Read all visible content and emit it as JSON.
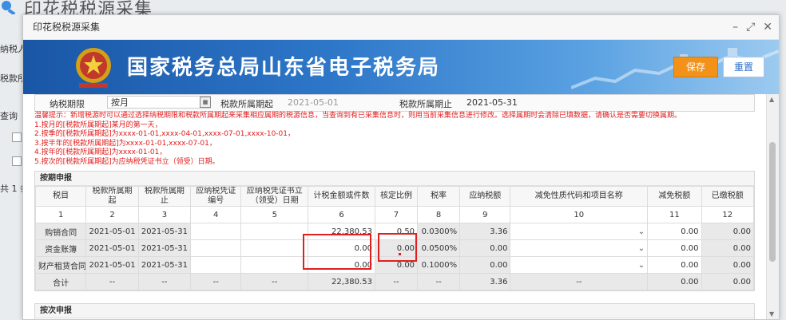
{
  "background": {
    "page_title": "印花税税源采集",
    "side_labels": [
      "纳税人",
      "税款所",
      "查询",
      "共 1 条"
    ]
  },
  "dialog": {
    "title": "印花税税源采集",
    "bureau_name": "国家税务总局山东省电子税务局",
    "buttons": {
      "save": "保存",
      "reset": "重置"
    }
  },
  "period": {
    "period_label": "纳税期限",
    "period_value": "按月",
    "start_label": "税款所属期起",
    "start_value": "2021-05-01",
    "end_label": "税款所属期止",
    "end_value": "2021-05-31"
  },
  "tips": [
    "温馨提示：新增税源时可以通过选择纳税期限和税款所属期起来采集相应属期的税源信息，当查询到有已采集信息时，则用当前采集信息进行修改。选择属期时会清除已填数据，请确认是否需要切换属期。",
    "1.按月的[税款所属期起]某月的第一天，",
    "2.按季的[税款所属期起]为xxxx-01-01,xxxx-04-01,xxxx-07-01,xxxx-10-01，",
    "3.按半年的[税款所属期起]为xxxx-01-01,xxxx-07-01，",
    "4.按年的[税款所属期起]为xxxx-01-01，",
    "5.按次的[税款所属期起]为应纳税凭证书立（领受）日期。"
  ],
  "period_section": {
    "title": "按期申报",
    "headers": [
      "税目",
      "税款所属期起",
      "税款所属期止",
      "应纳税凭证编号",
      "应纳税凭证书立（领受）日期",
      "计税金额或件数",
      "核定比例",
      "税率",
      "应纳税额",
      "减免性质代码和项目名称",
      "减免税额",
      "已缴税额"
    ],
    "col_numbers": [
      "1",
      "2",
      "3",
      "4",
      "5",
      "6",
      "7",
      "8",
      "9",
      "10",
      "11",
      "12"
    ],
    "rows": [
      {
        "item": "购销合同",
        "start": "2021-05-01",
        "end": "2021-05-31",
        "voucher_no": "",
        "voucher_date": "",
        "amount": "22,380.53",
        "ratio": "0.50",
        "rate": "0.0300%",
        "tax": "3.36",
        "relief_code": "",
        "relief_tax": "0.00",
        "paid_tax": "0.00"
      },
      {
        "item": "资金账簿",
        "start": "2021-05-01",
        "end": "2021-05-31",
        "voucher_no": "",
        "voucher_date": "",
        "amount": "0.00",
        "ratio": "0.00",
        "rate": "0.0500%",
        "tax": "0.00",
        "relief_code": "",
        "relief_tax": "0.00",
        "paid_tax": "0.00"
      },
      {
        "item": "财产租赁合同",
        "start": "2021-05-01",
        "end": "2021-05-31",
        "voucher_no": "",
        "voucher_date": "",
        "amount": "0.00",
        "ratio": "0.00",
        "rate": "0.1000%",
        "tax": "0.00",
        "relief_code": "",
        "relief_tax": "0.00",
        "paid_tax": "0.00"
      }
    ],
    "total": {
      "label": "合计",
      "start": "--",
      "end": "--",
      "voucher_no": "--",
      "voucher_date": "--",
      "amount": "22,380.53",
      "ratio": "--",
      "rate": "--",
      "tax": "3.36",
      "relief_code": "--",
      "relief_tax": "0.00",
      "paid_tax": "0.00"
    }
  },
  "per_time_section": {
    "title": "按次申报"
  },
  "colors": {
    "accent_save": "#f29218",
    "banner": "#2d76c8",
    "tip_red": "#e21b1b",
    "highlight": "#e02020"
  },
  "icons": [
    "search-icon",
    "minimize-icon",
    "maximize-icon",
    "close-icon",
    "calendar-icon",
    "chevron-down-icon",
    "emblem-icon"
  ]
}
